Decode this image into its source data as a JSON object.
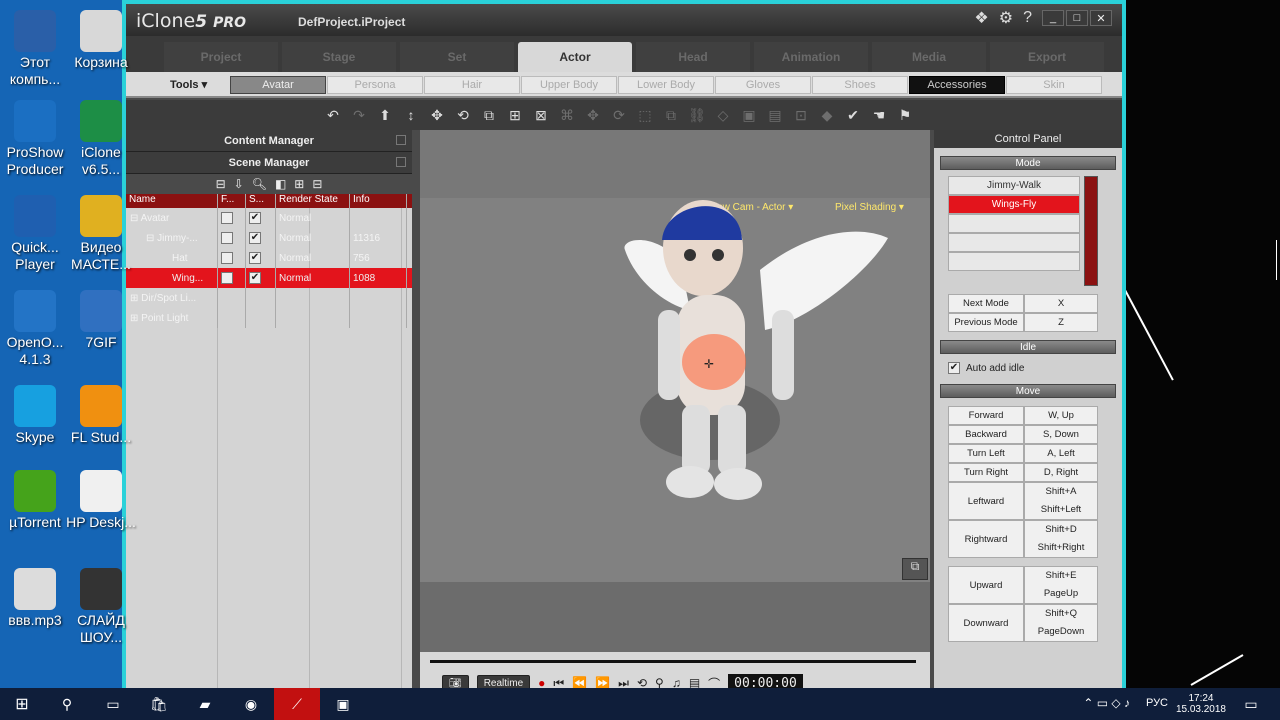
{
  "desktop": {
    "left_icons": [
      {
        "label": "Этот компь...",
        "icon": "computer-icon"
      },
      {
        "label": "ProShow Producer",
        "icon": "proshow-icon"
      },
      {
        "label": "Quick... Player",
        "icon": "quicktime-icon"
      },
      {
        "label": "OpenO... 4.1.3",
        "icon": "openoffice-icon"
      },
      {
        "label": "Skype",
        "icon": "skype-icon"
      },
      {
        "label": "µTorrent",
        "icon": "utorrent-icon"
      },
      {
        "label": "ввв.mp3",
        "icon": "mp3-file-icon"
      }
    ],
    "second_icons": [
      {
        "label": "Корзина",
        "icon": "recycle-bin-icon"
      },
      {
        "label": "iClone v6.5...",
        "icon": "iclone-icon"
      },
      {
        "label": "Видео МАСТЕ...",
        "icon": "video-master-icon"
      },
      {
        "label": "7GIF",
        "icon": "7gif-icon"
      },
      {
        "label": "FL Stud...",
        "icon": "fl-studio-icon"
      },
      {
        "label": "HP Deskj...",
        "icon": "hp-icon"
      },
      {
        "label": "СЛАЙД ШОУ...",
        "icon": "slideshow-icon"
      }
    ]
  },
  "app": {
    "logo": "iClone",
    "logo_version": "5",
    "logo_pro": "PRO",
    "project": "DefProject.iProject"
  },
  "main_tabs": [
    {
      "label": "Project",
      "active": false
    },
    {
      "label": "Stage",
      "active": false
    },
    {
      "label": "Set",
      "active": false
    },
    {
      "label": "Actor",
      "active": true
    },
    {
      "label": "Head",
      "active": false
    },
    {
      "label": "Animation",
      "active": false
    },
    {
      "label": "Media",
      "active": false
    },
    {
      "label": "Export",
      "active": false
    }
  ],
  "tools_label": "Tools ▾",
  "sub_tabs": [
    "Avatar",
    "Persona",
    "Hair",
    "Upper Body",
    "Lower Body",
    "Gloves",
    "Shoes",
    "Accessories",
    "Skin"
  ],
  "content_manager": "Content Manager",
  "scene_manager": "Scene Manager",
  "grid": {
    "headers": [
      "Name",
      "F...",
      "S...",
      "Render State",
      "Info"
    ],
    "rows": [
      {
        "name": "⊟ Avatar",
        "f": false,
        "s": true,
        "state": "Normal",
        "info": ""
      },
      {
        "name": "⊟ Jimmy-...",
        "f": false,
        "s": true,
        "state": "Normal",
        "info": "11316"
      },
      {
        "name": "Hat",
        "f": false,
        "s": true,
        "state": "Normal",
        "info": "756"
      },
      {
        "name": "Wing...",
        "f": false,
        "s": true,
        "state": "Normal",
        "info": "1088",
        "selected": true
      },
      {
        "name": "⊞ Dir/Spot Li...",
        "f": null,
        "s": null,
        "state": "",
        "info": ""
      },
      {
        "name": "⊞ Point Light",
        "f": null,
        "s": null,
        "state": "",
        "info": ""
      }
    ]
  },
  "viewport": {
    "camera": "Follow Cam - Actor ▾",
    "shading": "Pixel Shading ▾"
  },
  "timeline": {
    "realtime": "Realtime",
    "timecode": "00:00:00"
  },
  "control_panel": {
    "title": "Control Panel",
    "mode_label": "Mode",
    "modes": [
      {
        "label": "Jimmy-Walk",
        "selected": false
      },
      {
        "label": "Wings-Fly",
        "selected": true
      }
    ],
    "mode_keys": [
      {
        "k": "Next Mode",
        "v": "X"
      },
      {
        "k": "Previous Mode",
        "v": "Z"
      }
    ],
    "idle_label": "Idle",
    "auto_idle": "Auto add idle",
    "move_label": "Move",
    "move_keys": [
      {
        "k": "Forward",
        "v": [
          "W, Up"
        ]
      },
      {
        "k": "Backward",
        "v": [
          "S, Down"
        ]
      },
      {
        "k": "Turn Left",
        "v": [
          "A, Left"
        ]
      },
      {
        "k": "Turn Right",
        "v": [
          "D, Right"
        ]
      },
      {
        "k": "Leftward",
        "v": [
          "Shift+A",
          "Shift+Left"
        ]
      },
      {
        "k": "Rightward",
        "v": [
          "Shift+D",
          "Shift+Right"
        ]
      }
    ],
    "move_keys2": [
      {
        "k": "Upward",
        "v": [
          "Shift+E",
          "PageUp"
        ]
      },
      {
        "k": "Downward",
        "v": [
          "Shift+Q",
          "PageDown"
        ]
      }
    ]
  },
  "taskbar": {
    "lang": "РУС",
    "time": "17:24",
    "date": "15.03.2018"
  }
}
